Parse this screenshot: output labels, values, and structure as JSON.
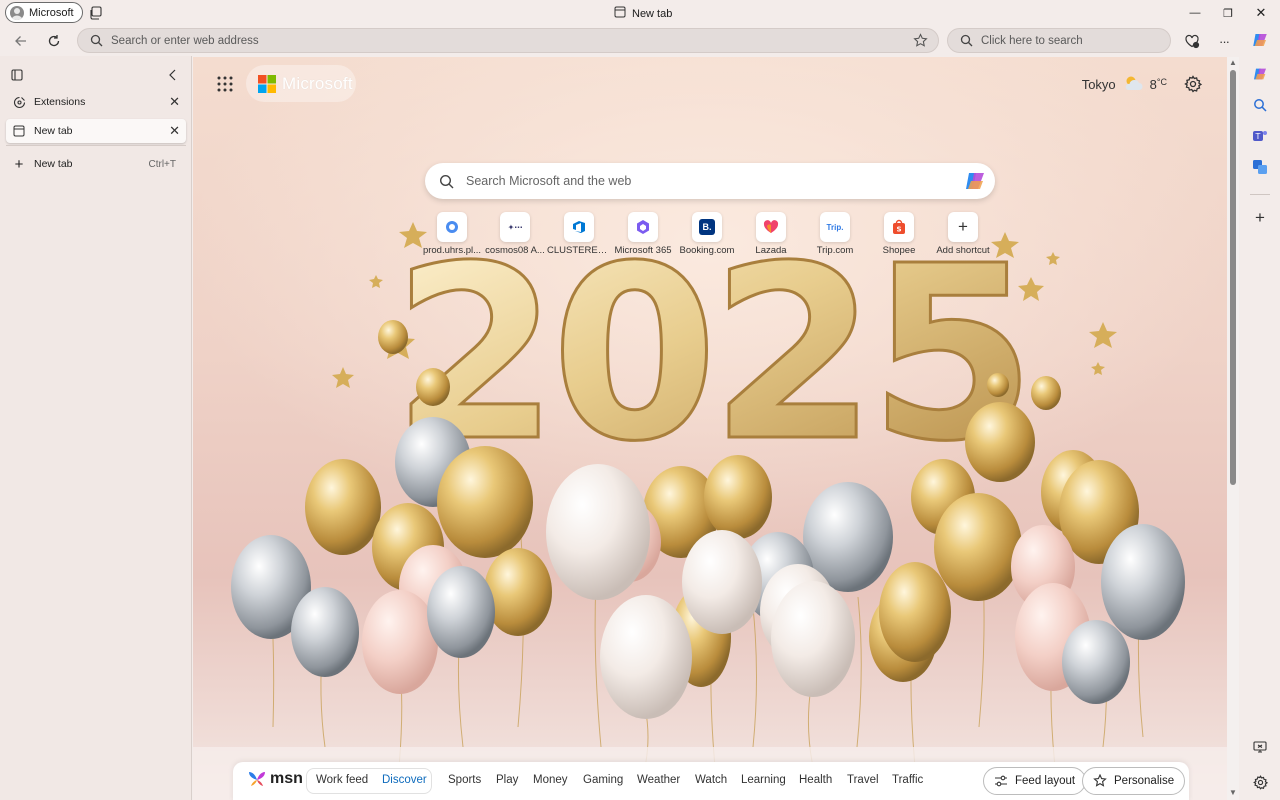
{
  "titlebar": {
    "profile_label": "Microsoft",
    "tab_title": "New tab",
    "controls": {
      "minimize": "—",
      "restore": "❐",
      "close": "✕"
    }
  },
  "toolbar": {
    "address_placeholder": "Search or enter web address",
    "search_placeholder": "Click here to search",
    "more_label": "···"
  },
  "vertical_tabs": {
    "extensions_label": "Extensions",
    "tabs": [
      {
        "label": "New tab"
      }
    ],
    "new_tab_label": "New tab",
    "new_tab_shortcut": "Ctrl+T"
  },
  "newtab": {
    "brand": "Microsoft",
    "weather": {
      "city": "Tokyo",
      "temp": "8",
      "unit": "°C"
    },
    "search_placeholder": "Search Microsoft and the web",
    "shortcuts": [
      {
        "label": "prod.uhrs.pl...",
        "icon": "uhrs-icon",
        "color": "#4a8cf0"
      },
      {
        "label": "cosmos08 A...",
        "icon": "cosmos-icon",
        "color": "#3c3c70"
      },
      {
        "label": "CLUSTERED ...",
        "icon": "azure-devops-icon",
        "color": "#0078d4"
      },
      {
        "label": "Microsoft 365",
        "icon": "m365-icon",
        "color": "#7b5cf0"
      },
      {
        "label": "Booking.com",
        "icon": "booking-icon",
        "color": "#003580"
      },
      {
        "label": "Lazada",
        "icon": "lazada-icon",
        "color": "#f0426b"
      },
      {
        "label": "Trip.com",
        "icon": "trip-icon",
        "color": "#2f7ae5"
      },
      {
        "label": "Shopee",
        "icon": "shopee-icon",
        "color": "#ee4d2d"
      },
      {
        "label": "Add shortcut",
        "icon": "plus-icon",
        "color": "#333333"
      }
    ],
    "hero_text": "2025"
  },
  "msn": {
    "logo_text": "msn",
    "nav": [
      "Work feed",
      "Discover",
      "Sports",
      "Play",
      "Money",
      "Gaming",
      "Weather",
      "Watch",
      "Learning",
      "Health",
      "Travel",
      "Traffic"
    ],
    "active": "Discover",
    "feed_layout": "Feed layout",
    "personalise": "Personalise"
  },
  "shortcut_glyphs": {
    "booking": "B.",
    "trip": "Trip.",
    "plus": "+"
  }
}
